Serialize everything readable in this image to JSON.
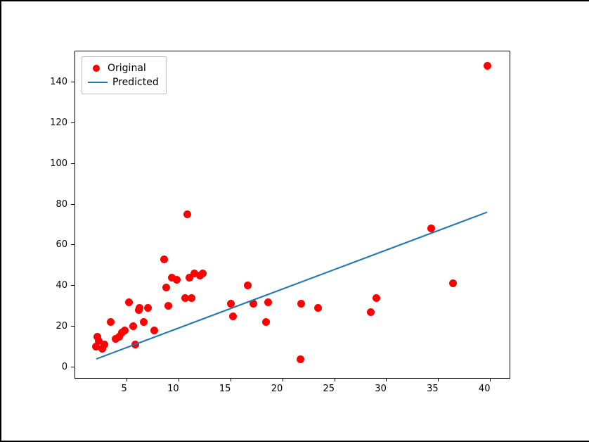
{
  "chart_data": {
    "type": "scatter",
    "xlim": [
      0,
      42
    ],
    "ylim": [
      -6,
      155
    ],
    "x_ticks": [
      5,
      10,
      15,
      20,
      25,
      30,
      35,
      40
    ],
    "y_ticks": [
      0,
      20,
      40,
      60,
      80,
      100,
      120,
      140
    ],
    "title": "",
    "xlabel": "",
    "ylabel": "",
    "series": [
      {
        "name": "Original",
        "kind": "scatter",
        "color": "#ff0000",
        "x": [
          2.0,
          2.1,
          2.3,
          2.6,
          2.8,
          3.4,
          3.9,
          4.2,
          4.5,
          4.8,
          5.2,
          5.6,
          5.8,
          6.1,
          6.2,
          6.6,
          7.0,
          7.6,
          8.6,
          8.8,
          9.0,
          9.3,
          9.8,
          10.6,
          10.8,
          11.0,
          11.2,
          11.5,
          12.0,
          12.3,
          15.0,
          15.2,
          16.6,
          17.2,
          18.4,
          18.6,
          21.7,
          21.8,
          23.4,
          28.5,
          29.0,
          34.3,
          36.4,
          39.7
        ],
        "y": [
          10,
          15,
          13,
          9,
          11,
          22,
          14,
          15,
          17,
          18,
          32,
          20,
          11,
          28,
          29,
          22,
          29,
          18,
          53,
          39,
          30,
          44,
          43,
          34,
          75,
          44,
          34,
          46,
          45,
          46,
          31,
          25,
          40,
          31,
          22,
          32,
          4,
          31,
          29,
          27,
          34,
          68,
          41,
          148
        ]
      },
      {
        "name": "Predicted",
        "kind": "line",
        "color": "#1f77b4",
        "x": [
          2.0,
          39.7
        ],
        "y": [
          4.1,
          76.2
        ]
      }
    ],
    "legend": {
      "position": "upper-left",
      "entries": [
        "Original",
        "Predicted"
      ]
    }
  }
}
